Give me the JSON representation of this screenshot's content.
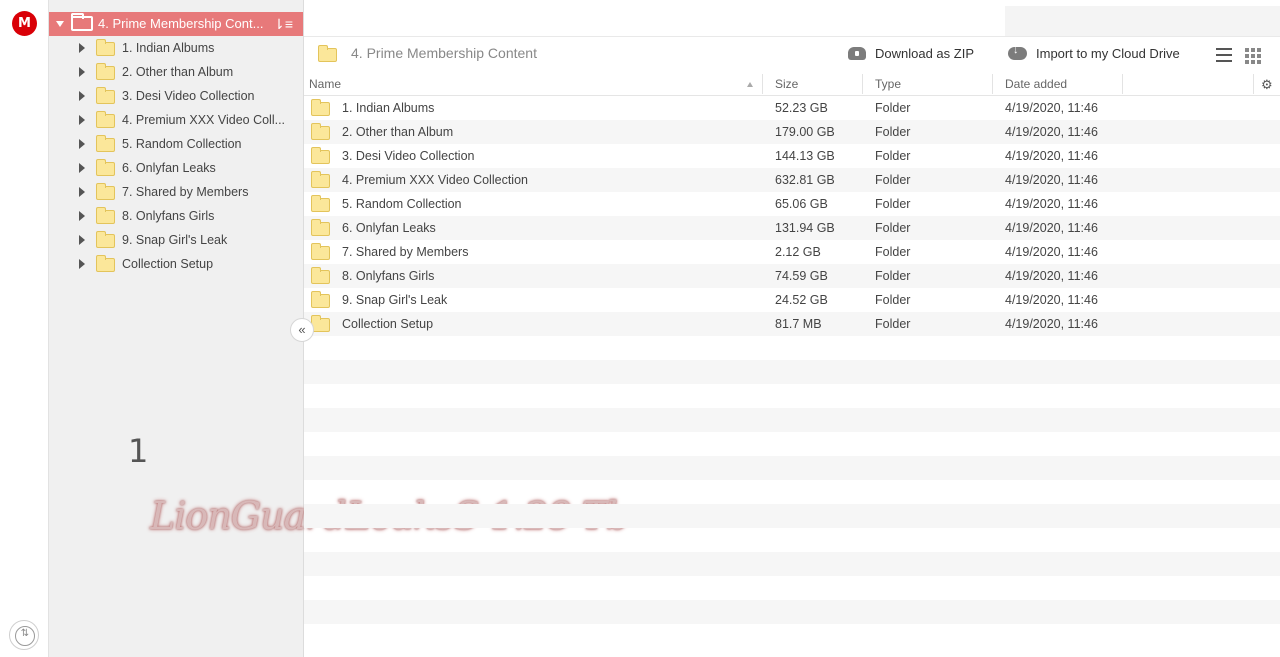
{
  "app": {
    "logo_letter": "M",
    "brand_color": "#d90007"
  },
  "tree": {
    "title": "4. Prime Membership Cont...",
    "items": [
      {
        "label": "1. Indian Albums"
      },
      {
        "label": "2. Other than Album"
      },
      {
        "label": "3. Desi Video Collection"
      },
      {
        "label": "4. Premium XXX Video Coll..."
      },
      {
        "label": "5. Random Collection"
      },
      {
        "label": "6. Onlyfan Leaks"
      },
      {
        "label": "7. Shared by Members"
      },
      {
        "label": "8. Onlyfans Girls"
      },
      {
        "label": "9. Snap Girl's Leak"
      },
      {
        "label": "Collection Setup"
      }
    ]
  },
  "toolbar": {
    "breadcrumb": "4. Prime Membership Content",
    "download_zip": "Download as ZIP",
    "import": "Import to my Cloud Drive"
  },
  "table": {
    "headers": {
      "name": "Name",
      "size": "Size",
      "type": "Type",
      "date": "Date added"
    },
    "rows": [
      {
        "name": "1. Indian Albums",
        "size": "52.23 GB",
        "type": "Folder",
        "date": "4/19/2020, 11:46"
      },
      {
        "name": "2. Other than Album",
        "size": "179.00 GB",
        "type": "Folder",
        "date": "4/19/2020, 11:46"
      },
      {
        "name": "3. Desi Video Collection",
        "size": "144.13 GB",
        "type": "Folder",
        "date": "4/19/2020, 11:46"
      },
      {
        "name": "4. Premium XXX Video Collection",
        "size": "632.81 GB",
        "type": "Folder",
        "date": "4/19/2020, 11:46"
      },
      {
        "name": "5. Random Collection",
        "size": "65.06 GB",
        "type": "Folder",
        "date": "4/19/2020, 11:46"
      },
      {
        "name": "6. Onlyfan Leaks",
        "size": "131.94 GB",
        "type": "Folder",
        "date": "4/19/2020, 11:46"
      },
      {
        "name": "7. Shared by Members",
        "size": "2.12 GB",
        "type": "Folder",
        "date": "4/19/2020, 11:46"
      },
      {
        "name": "8. Onlyfans Girls",
        "size": "74.59 GB",
        "type": "Folder",
        "date": "4/19/2020, 11:46"
      },
      {
        "name": "9. Snap Girl's Leak",
        "size": "24.52 GB",
        "type": "Folder",
        "date": "4/19/2020, 11:46"
      },
      {
        "name": "Collection Setup",
        "size": "81.7 MB",
        "type": "Folder",
        "date": "4/19/2020, 11:46"
      }
    ]
  },
  "overlay": {
    "number": "1",
    "watermark": "LionGuardLeaksS 1.28 Tb"
  }
}
